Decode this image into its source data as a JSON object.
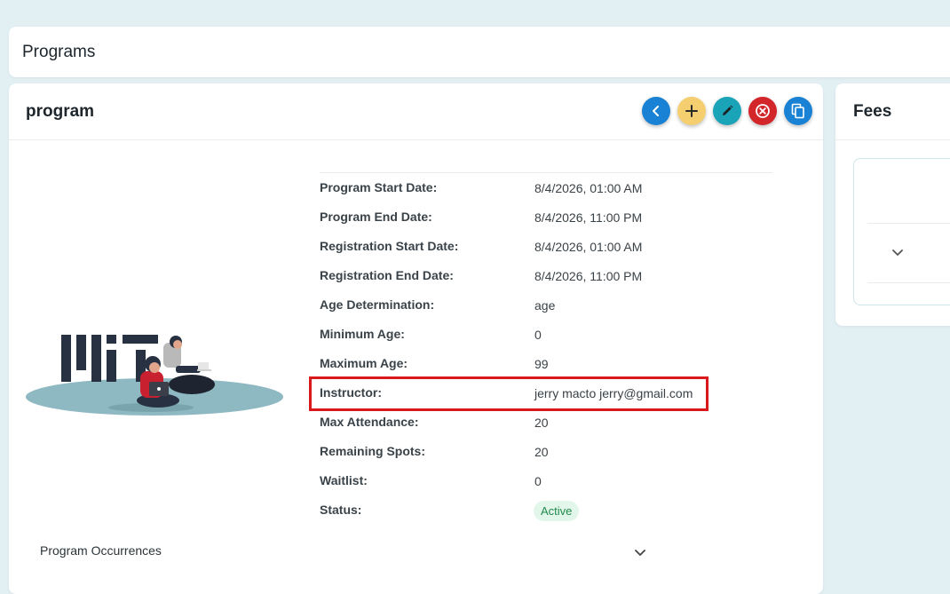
{
  "header": {
    "title": "Programs"
  },
  "program_card": {
    "title": "program",
    "actions": [
      {
        "name": "back-button",
        "icon": "chevron-left-icon",
        "color": "#1a82d4"
      },
      {
        "name": "add-button",
        "icon": "plus-icon",
        "color": "#f5cf6f"
      },
      {
        "name": "edit-button",
        "icon": "pencil-icon",
        "color": "#1ba3b8"
      },
      {
        "name": "cancel-button",
        "icon": "circle-x-icon",
        "color": "#d2262b"
      },
      {
        "name": "copy-button",
        "icon": "copy-icon",
        "color": "#1a82d4"
      }
    ],
    "details": [
      {
        "label": "Program Start Date:",
        "value": "8/4/2026, 01:00 AM"
      },
      {
        "label": "Program End Date:",
        "value": "8/4/2026, 11:00 PM"
      },
      {
        "label": "Registration Start Date:",
        "value": "8/4/2026, 01:00 AM"
      },
      {
        "label": "Registration End Date:",
        "value": "8/4/2026, 11:00 PM"
      },
      {
        "label": "Age Determination:",
        "value": "age"
      },
      {
        "label": "Minimum Age:",
        "value": "0"
      },
      {
        "label": "Maximum Age:",
        "value": "99"
      },
      {
        "label": "Instructor:",
        "value": "jerry macto jerry@gmail.com"
      },
      {
        "label": "Max Attendance:",
        "value": "20"
      },
      {
        "label": "Remaining Spots:",
        "value": "20"
      },
      {
        "label": "Waitlist:",
        "value": "0"
      },
      {
        "label": "Status:",
        "value": "Active"
      }
    ],
    "occurrences_label": "Program Occurrences"
  },
  "fees_card": {
    "title": "Fees"
  },
  "colors": {
    "status_active_bg": "#e3f6ea",
    "status_active_text": "#1f8b4c",
    "highlight": "#d9191c"
  }
}
